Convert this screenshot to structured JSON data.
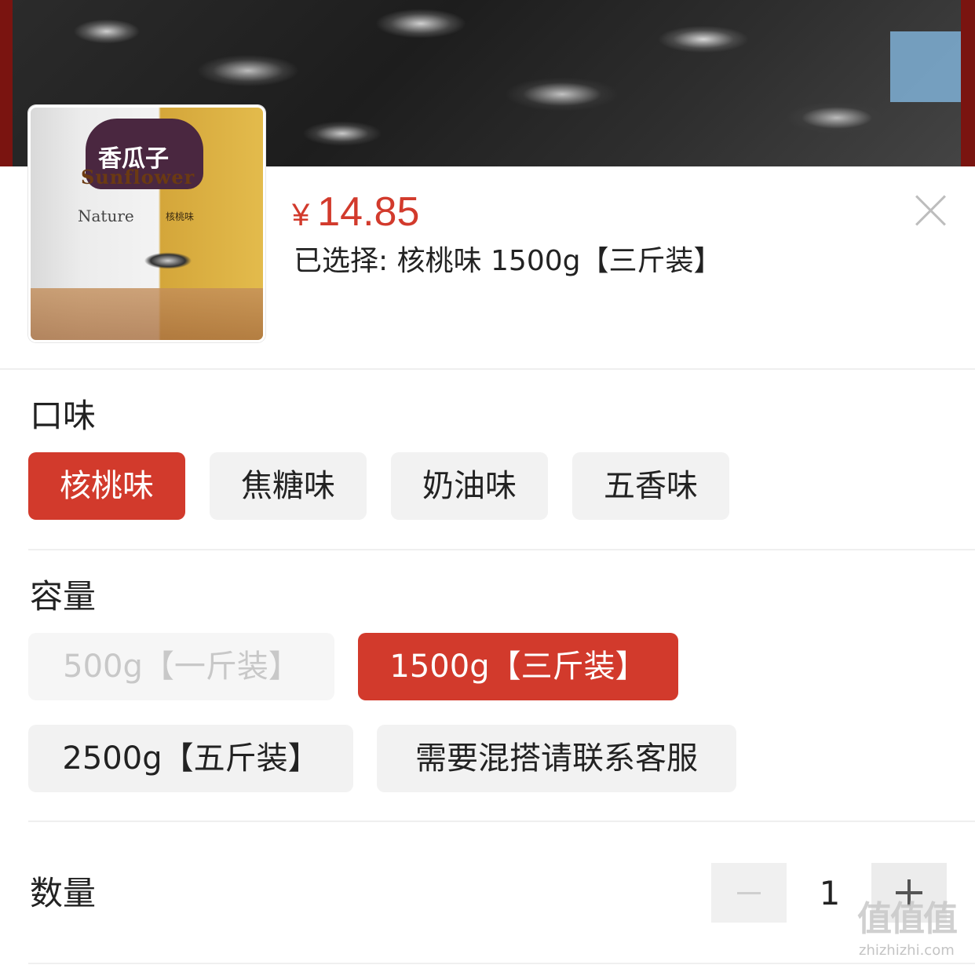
{
  "product": {
    "thumb_pack_cn": "香瓜子",
    "thumb_pack_en": "Sunflower",
    "thumb_pack_nature": "Nature",
    "thumb_pack_flavor": "核桃味",
    "price_symbol": "¥",
    "price": "14.85",
    "selected_text": "已选择: 核桃味 1500g【三斤装】"
  },
  "flavor": {
    "title": "口味",
    "options": [
      {
        "label": "核桃味",
        "state": "active"
      },
      {
        "label": "焦糖味",
        "state": "normal"
      },
      {
        "label": "奶油味",
        "state": "normal"
      },
      {
        "label": "五香味",
        "state": "normal"
      }
    ]
  },
  "capacity": {
    "title": "容量",
    "options": [
      {
        "label": "500g【一斤装】",
        "state": "disabled"
      },
      {
        "label": "1500g【三斤装】",
        "state": "active"
      },
      {
        "label": "2500g【五斤装】",
        "state": "normal"
      },
      {
        "label": "需要混搭请联系客服",
        "state": "normal"
      }
    ]
  },
  "quantity": {
    "title": "数量",
    "value": "1"
  },
  "watermark": {
    "main": "值值值",
    "sub": "zhizhizhi.com"
  },
  "colors": {
    "accent": "#d23a2c",
    "option_bg": "#f2f2f2"
  }
}
